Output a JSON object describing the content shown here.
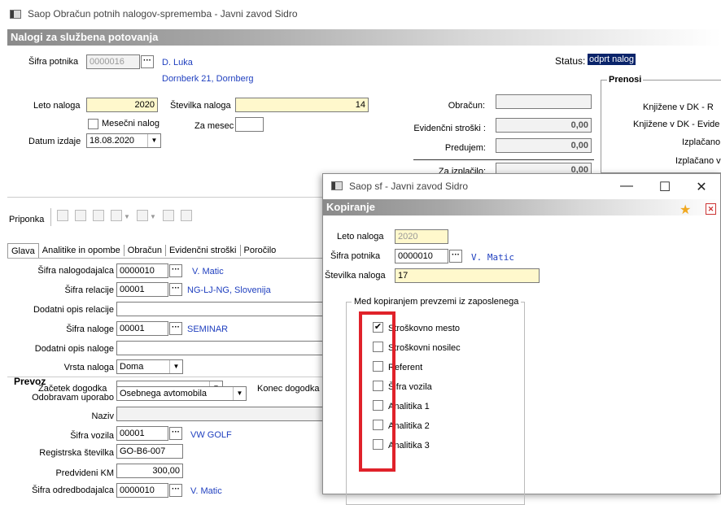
{
  "main": {
    "window_title": "Saop Obračun potnih nalogov-sprememba - Javni zavod Sidro",
    "header": "Nalogi za službena potovanja",
    "employee": {
      "label": "Šifra potnika",
      "code": "0000016",
      "name": "D. Luka",
      "address": "Dornberk 21, Dornberg"
    },
    "status": {
      "label": "Status:",
      "value": "odprt nalog"
    },
    "leto": {
      "label": "Leto naloga",
      "value": "2020"
    },
    "stevilka": {
      "label": "Številka naloga",
      "value": "14"
    },
    "mesecni": {
      "label": "Mesečni nalog"
    },
    "za_mesec": {
      "label": "Za mesec",
      "value": ""
    },
    "datum": {
      "label": "Datum izdaje",
      "value": "18.08.2020"
    },
    "obracun": {
      "label": "Obračun:",
      "value": ""
    },
    "evidencni": {
      "label": "Evidenčni stroški :",
      "value": "0,00"
    },
    "predujem": {
      "label": "Predujem:",
      "value": "0,00"
    },
    "za_izplacilo": {
      "label": "Za izplačilo:",
      "value": "0,00"
    },
    "prenosi": {
      "title": "Prenosi",
      "items": [
        "Knjižene v DK - R",
        "Knjižene v DK - Evide",
        "Izplačano",
        "Izplačano v"
      ]
    },
    "priponka": "Priponka",
    "tabs": [
      "Glava",
      "Analitike in opombe",
      "Obračun",
      "Evidenčni stroški",
      "Poročilo"
    ],
    "glava": {
      "nalogodajalec": {
        "label": "Šifra nalogodajalca",
        "code": "0000010",
        "name": "V. Matic"
      },
      "relacija": {
        "label": "Šifra relacije",
        "code": "00001",
        "name": "NG-LJ-NG, Slovenija"
      },
      "opis_relacije": {
        "label": "Dodatni opis relacije",
        "value": ""
      },
      "naloge": {
        "label": "Šifra naloge",
        "code": "00001",
        "name": "SEMINAR"
      },
      "opis_naloge": {
        "label": "Dodatni opis naloge",
        "value": ""
      },
      "vrsta": {
        "label": "Vrsta naloga",
        "value": "Doma"
      },
      "zacetek": {
        "label": "Začetek dogodka",
        "value": ""
      },
      "konec": {
        "label": "Konec dogodka"
      }
    },
    "prevoz": {
      "title": "Prevoz",
      "odobravam": {
        "label": "Odobravam uporabo",
        "value": "Osebnega avtomobila"
      },
      "naziv": {
        "label": "Naziv",
        "value": ""
      },
      "vozilo": {
        "label": "Šifra vozila",
        "code": "00001",
        "name": "VW GOLF"
      },
      "registrska": {
        "label": "Registrska številka",
        "value": "GO-B6-007"
      },
      "km": {
        "label": "Predvideni KM",
        "value": "300,00"
      },
      "odredbodajalec": {
        "label": "Šifra odredbodajalca",
        "code": "0000010",
        "name": "V. Matic"
      }
    }
  },
  "dialog": {
    "window_title": "Saop sf - Javni zavod Sidro",
    "header": "Kopiranje",
    "leto": {
      "label": "Leto naloga",
      "value": "2020"
    },
    "potnik": {
      "label": "Šifra potnika",
      "code": "0000010",
      "name": "V. Matic"
    },
    "stevilka": {
      "label": "Številka naloga",
      "value": "17"
    },
    "group_label": "Med kopiranjem prevzemi iz zaposlenega",
    "options": [
      {
        "label": "Stroškovno mesto",
        "checked": true
      },
      {
        "label": "Stroškovni nosilec",
        "checked": false
      },
      {
        "label": "Referent",
        "checked": false
      },
      {
        "label": "Šifra vozila",
        "checked": false
      },
      {
        "label": "Analitika 1",
        "checked": false
      },
      {
        "label": "Analitika 2",
        "checked": false
      },
      {
        "label": "Analitika 3",
        "checked": false
      }
    ]
  },
  "icons": [
    "window-icon",
    "ellipsis-icon",
    "dropdown-arrow-icon",
    "star-icon",
    "pdf-icon",
    "minimize-icon",
    "maximize-icon",
    "close-icon"
  ]
}
